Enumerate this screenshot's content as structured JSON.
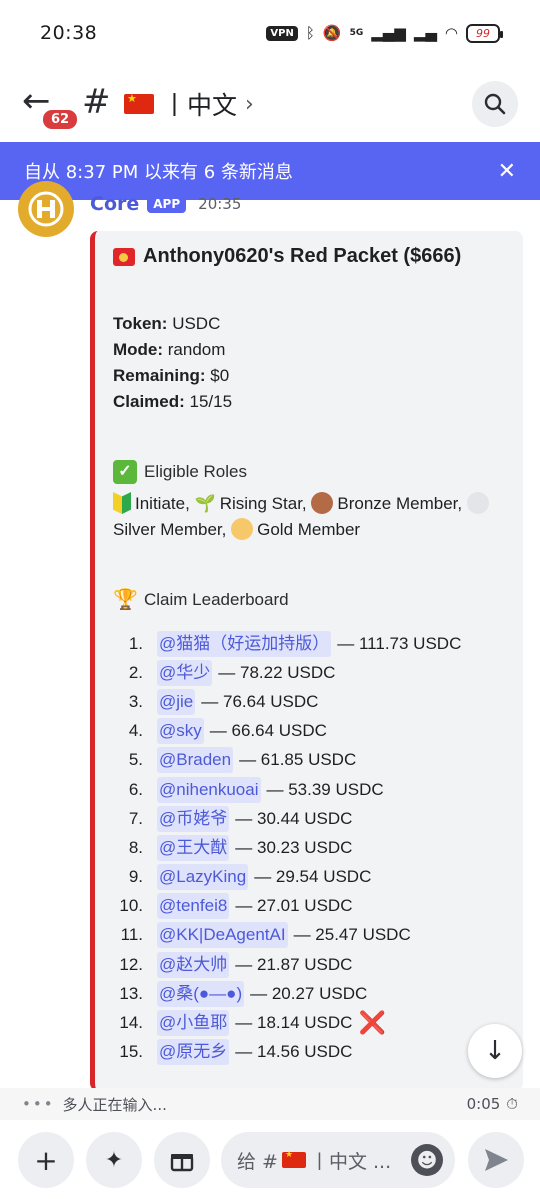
{
  "status": {
    "time": "20:38",
    "vpn": "VPN",
    "net": "5G",
    "battery": "99"
  },
  "header": {
    "unread": "62",
    "channel_name": "丨中文"
  },
  "banner": {
    "text": "自从 8:37 PM 以来有 6 条新消息"
  },
  "message": {
    "author": "Core",
    "tag": "APP",
    "time": "20:35",
    "embed": {
      "title": "Anthony0620's Red Packet ($666)",
      "fields": [
        {
          "label": "Token:",
          "value": " USDC"
        },
        {
          "label": "Mode:",
          "value": " random"
        },
        {
          "label": "Remaining:",
          "value": " $0"
        },
        {
          "label": "Claimed:",
          "value": " 15/15"
        }
      ],
      "eligible_heading": "Eligible Roles",
      "roles": {
        "initiate": "Initiate,",
        "rising": "Rising Star,",
        "bronze": "Bronze Member,",
        "silver": "Silver Member,",
        "gold": "Gold Member"
      },
      "role_colors": {
        "bronze": "#b36b45",
        "silver": "#e3e5e8",
        "gold": "#f7c86a"
      },
      "leaderboard_heading": "Claim Leaderboard",
      "leaderboard": [
        {
          "rank": "1.",
          "user": "@猫猫（好运加持版）",
          "amount": "— 111.73 USDC"
        },
        {
          "rank": "2.",
          "user": "@华少",
          "amount": "— 78.22 USDC"
        },
        {
          "rank": "3.",
          "user": "@jie",
          "amount": "— 76.64 USDC"
        },
        {
          "rank": "4.",
          "user": "@sky",
          "amount": "— 66.64 USDC"
        },
        {
          "rank": "5.",
          "user": "@Braden",
          "amount": "— 61.85 USDC"
        },
        {
          "rank": "6.",
          "user": "@nihenkuoai",
          "amount": "— 53.39 USDC"
        },
        {
          "rank": "7.",
          "user": "@币姥爷",
          "amount": "— 30.44 USDC"
        },
        {
          "rank": "8.",
          "user": "@王大猷",
          "amount": "— 30.23 USDC"
        },
        {
          "rank": "9.",
          "user": "@LazyKing",
          "amount": "— 29.54 USDC"
        },
        {
          "rank": "10.",
          "user": "@tenfei8",
          "amount": "— 27.01 USDC"
        },
        {
          "rank": "11.",
          "user": "@KK|DeAgentAI",
          "amount": "— 25.47 USDC"
        },
        {
          "rank": "12.",
          "user": "@赵大帅",
          "amount": "— 21.87 USDC"
        },
        {
          "rank": "13.",
          "user": "@桑(●—●)",
          "amount": "— 20.27 USDC"
        },
        {
          "rank": "14.",
          "user": "@小鱼耶",
          "amount": "— 18.14 USDC",
          "mark": "❌"
        },
        {
          "rank": "15.",
          "user": "@原无乡",
          "amount": "— 14.56 USDC"
        }
      ]
    }
  },
  "typing": {
    "text": "多人正在输入...",
    "timer": "0:05"
  },
  "composer": {
    "prefix": "给 #",
    "channel": "丨中文 ..."
  }
}
